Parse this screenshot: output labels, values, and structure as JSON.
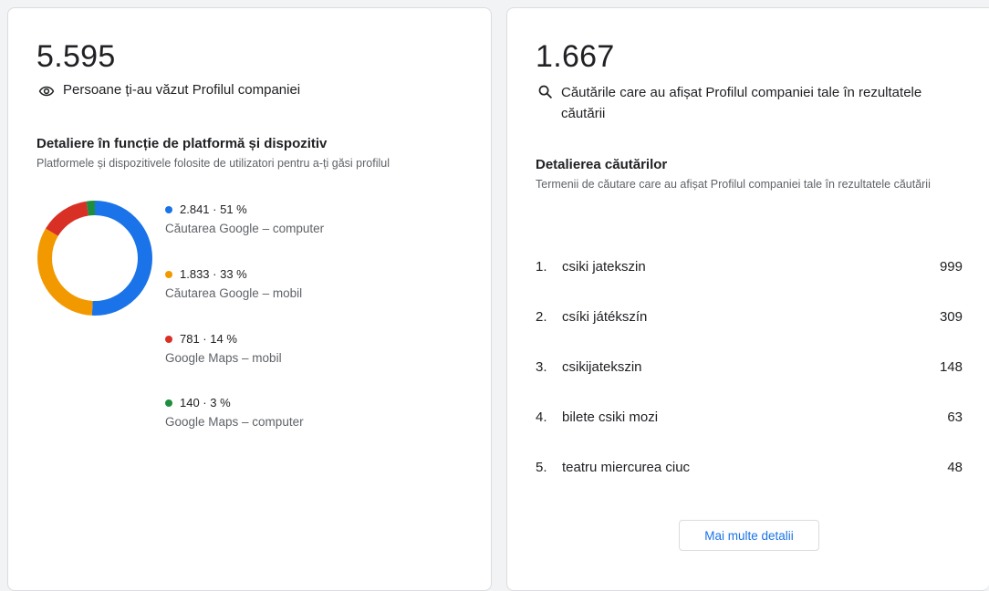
{
  "views_card": {
    "total": "5.595",
    "subtitle": "Persoane ți-au văzut Profilul companiei",
    "subtitle_icon": "eye-icon",
    "breakdown_title": "Detaliere în funcție de platformă și dispozitiv",
    "breakdown_desc": "Platformele și dispozitivele folosite de utilizatori pentru a-ți găsi profilul",
    "legend": [
      {
        "value": "2.841 · 51 %",
        "label": "Căutarea Google – computer",
        "color": "#1a73e8"
      },
      {
        "value": "1.833 · 33 %",
        "label": "Căutarea Google – mobil",
        "color": "#f29900"
      },
      {
        "value": "781 · 14 %",
        "label": "Google Maps – mobil",
        "color": "#d93025"
      },
      {
        "value": "140 · 3 %",
        "label": "Google Maps – computer",
        "color": "#1e8e3e"
      }
    ]
  },
  "chart_data": {
    "type": "pie",
    "categories": [
      "Căutarea Google – computer",
      "Căutarea Google – mobil",
      "Google Maps – mobil",
      "Google Maps – computer"
    ],
    "values": [
      2841,
      1833,
      781,
      140
    ],
    "percentages": [
      51,
      33,
      14,
      3
    ],
    "colors": [
      "#1a73e8",
      "#f29900",
      "#d93025",
      "#1e8e3e"
    ],
    "style": "donut"
  },
  "searches_card": {
    "total": "1.667",
    "subtitle": "Căutările care au afișat Profilul companiei tale în rezultatele căutării",
    "subtitle_icon": "search-icon",
    "breakdown_title": "Detalierea căutărilor",
    "breakdown_desc": "Termenii de căutare care au afișat Profilul companiei tale în rezultatele căutării",
    "terms": [
      {
        "rank": "1.",
        "term": "csiki jatekszin",
        "count": "999"
      },
      {
        "rank": "2.",
        "term": "csíki játékszín",
        "count": "309"
      },
      {
        "rank": "3.",
        "term": "csikijatekszin",
        "count": "148"
      },
      {
        "rank": "4.",
        "term": "bilete csiki mozi",
        "count": "63"
      },
      {
        "rank": "5.",
        "term": "teatru miercurea ciuc",
        "count": "48"
      }
    ],
    "more_button": "Mai multe detalii"
  }
}
